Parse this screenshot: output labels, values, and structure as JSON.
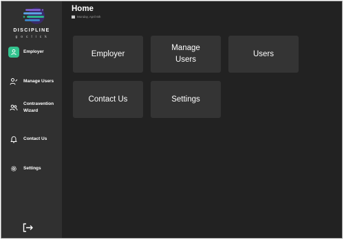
{
  "app": {
    "logo_title": "DISCIPLINE",
    "logo_tagline": "g o  c l i c k",
    "logo_colors": [
      "#3b82c4",
      "#2bb58a",
      "#7b5cc9",
      "#5aa0e0"
    ]
  },
  "header": {
    "title": "Home",
    "date": "Monday, April 6th"
  },
  "sidebar": {
    "items": [
      {
        "label": "Employer",
        "icon": "user-icon",
        "active": true
      },
      {
        "label": "Manage Users",
        "icon": "user-edit-icon",
        "active": false
      },
      {
        "label": "Contravention Wizard",
        "icon": "users-icon",
        "active": false
      },
      {
        "label": "Contact Us",
        "icon": "bell-icon",
        "active": false
      },
      {
        "label": "Settings",
        "icon": "gear-icon",
        "active": false
      }
    ],
    "logout_icon": "logout-icon"
  },
  "tiles": [
    {
      "label": "Employer"
    },
    {
      "label": "Manage Users"
    },
    {
      "label": "Users"
    },
    {
      "label": "Contact Us"
    },
    {
      "label": "Settings"
    }
  ],
  "colors": {
    "background": "#222222",
    "sidebar": "#303030",
    "tile": "#343434",
    "accent": "#33c48f"
  }
}
